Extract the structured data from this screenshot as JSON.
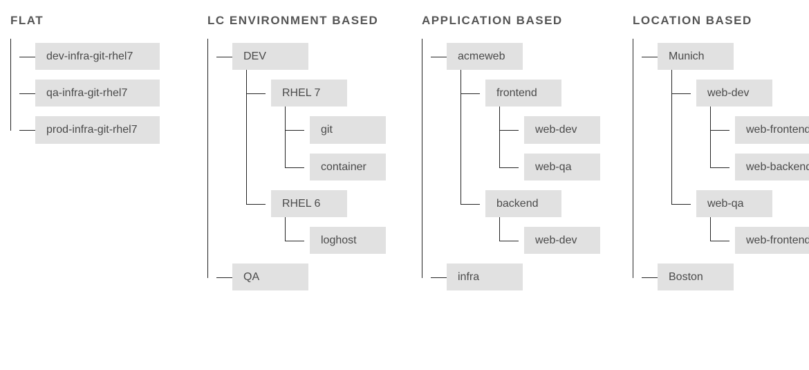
{
  "columns": [
    {
      "id": "flat",
      "title": "FLAT",
      "nodes": [
        {
          "label": "dev-infra-git-rhel7"
        },
        {
          "label": "qa-infra-git-rhel7"
        },
        {
          "label": "prod-infra-git-rhel7"
        }
      ]
    },
    {
      "id": "lc",
      "title": "LC ENVIRONMENT BASED",
      "nodes": [
        {
          "label": "DEV",
          "children": [
            {
              "label": "RHEL 7",
              "children": [
                {
                  "label": "git"
                },
                {
                  "label": "container"
                }
              ]
            },
            {
              "label": "RHEL 6",
              "children": [
                {
                  "label": "loghost"
                }
              ]
            }
          ]
        },
        {
          "label": "QA"
        }
      ]
    },
    {
      "id": "app",
      "title": "APPLICATION BASED",
      "nodes": [
        {
          "label": "acmeweb",
          "children": [
            {
              "label": "frontend",
              "children": [
                {
                  "label": "web-dev"
                },
                {
                  "label": "web-qa"
                }
              ]
            },
            {
              "label": "backend",
              "children": [
                {
                  "label": "web-dev"
                }
              ]
            }
          ]
        },
        {
          "label": "infra"
        }
      ]
    },
    {
      "id": "loc",
      "title": "LOCATION BASED",
      "nodes": [
        {
          "label": "Munich",
          "children": [
            {
              "label": "web-dev",
              "children": [
                {
                  "label": "web-frontend"
                },
                {
                  "label": "web-backend"
                }
              ]
            },
            {
              "label": "web-qa",
              "children": [
                {
                  "label": "web-frontend"
                }
              ]
            }
          ]
        },
        {
          "label": "Boston"
        }
      ]
    }
  ]
}
